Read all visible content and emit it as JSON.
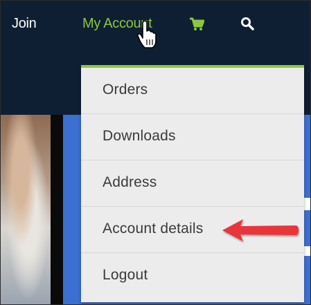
{
  "nav": {
    "join_label": "Join",
    "account_label": "My Account",
    "cart_icon": "shopping-cart-icon",
    "search_icon": "search-icon"
  },
  "dropdown": {
    "accent_color": "#8cc63f",
    "items": [
      {
        "label": "Orders"
      },
      {
        "label": "Downloads"
      },
      {
        "label": "Address"
      },
      {
        "label": "Account details"
      },
      {
        "label": "Logout"
      }
    ]
  },
  "annotation": {
    "arrow_color": "#e8343a",
    "points_to": "Account details"
  },
  "colors": {
    "navbar_bg": "#0f1f33",
    "account_link": "#8cc63f",
    "panel_blue": "#3b6fd1"
  }
}
